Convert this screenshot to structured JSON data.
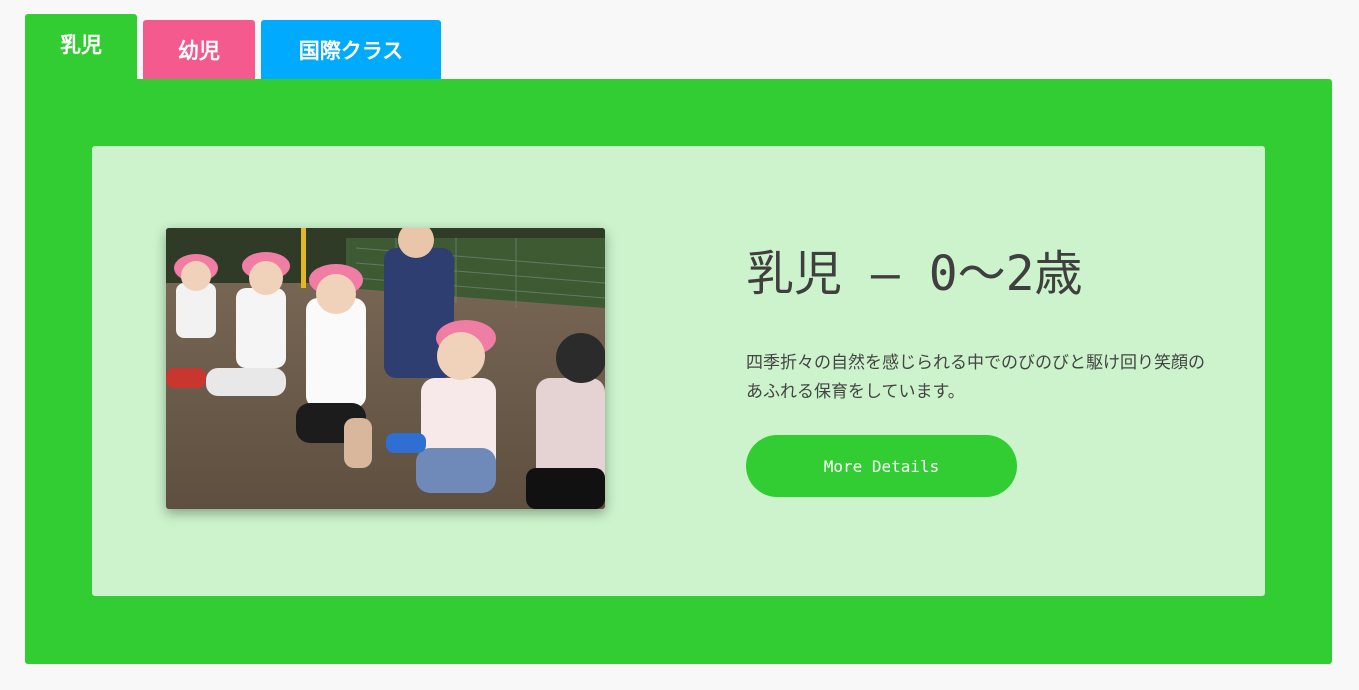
{
  "tabs": [
    {
      "label": "乳児"
    },
    {
      "label": "幼児"
    },
    {
      "label": "国際クラス"
    }
  ],
  "colors": {
    "infant": "#32cd32",
    "toddler": "#f55a8e",
    "international": "#00aaff",
    "card_background": "#ccf3cc",
    "page_background": "#f8f8f8"
  },
  "card": {
    "title": "乳児 – 0〜2歳",
    "description": "四季折々の自然を感じられる中でのびのびと駆け回り笑顔のあふれる保育をしています。",
    "button_label": "More Details"
  }
}
